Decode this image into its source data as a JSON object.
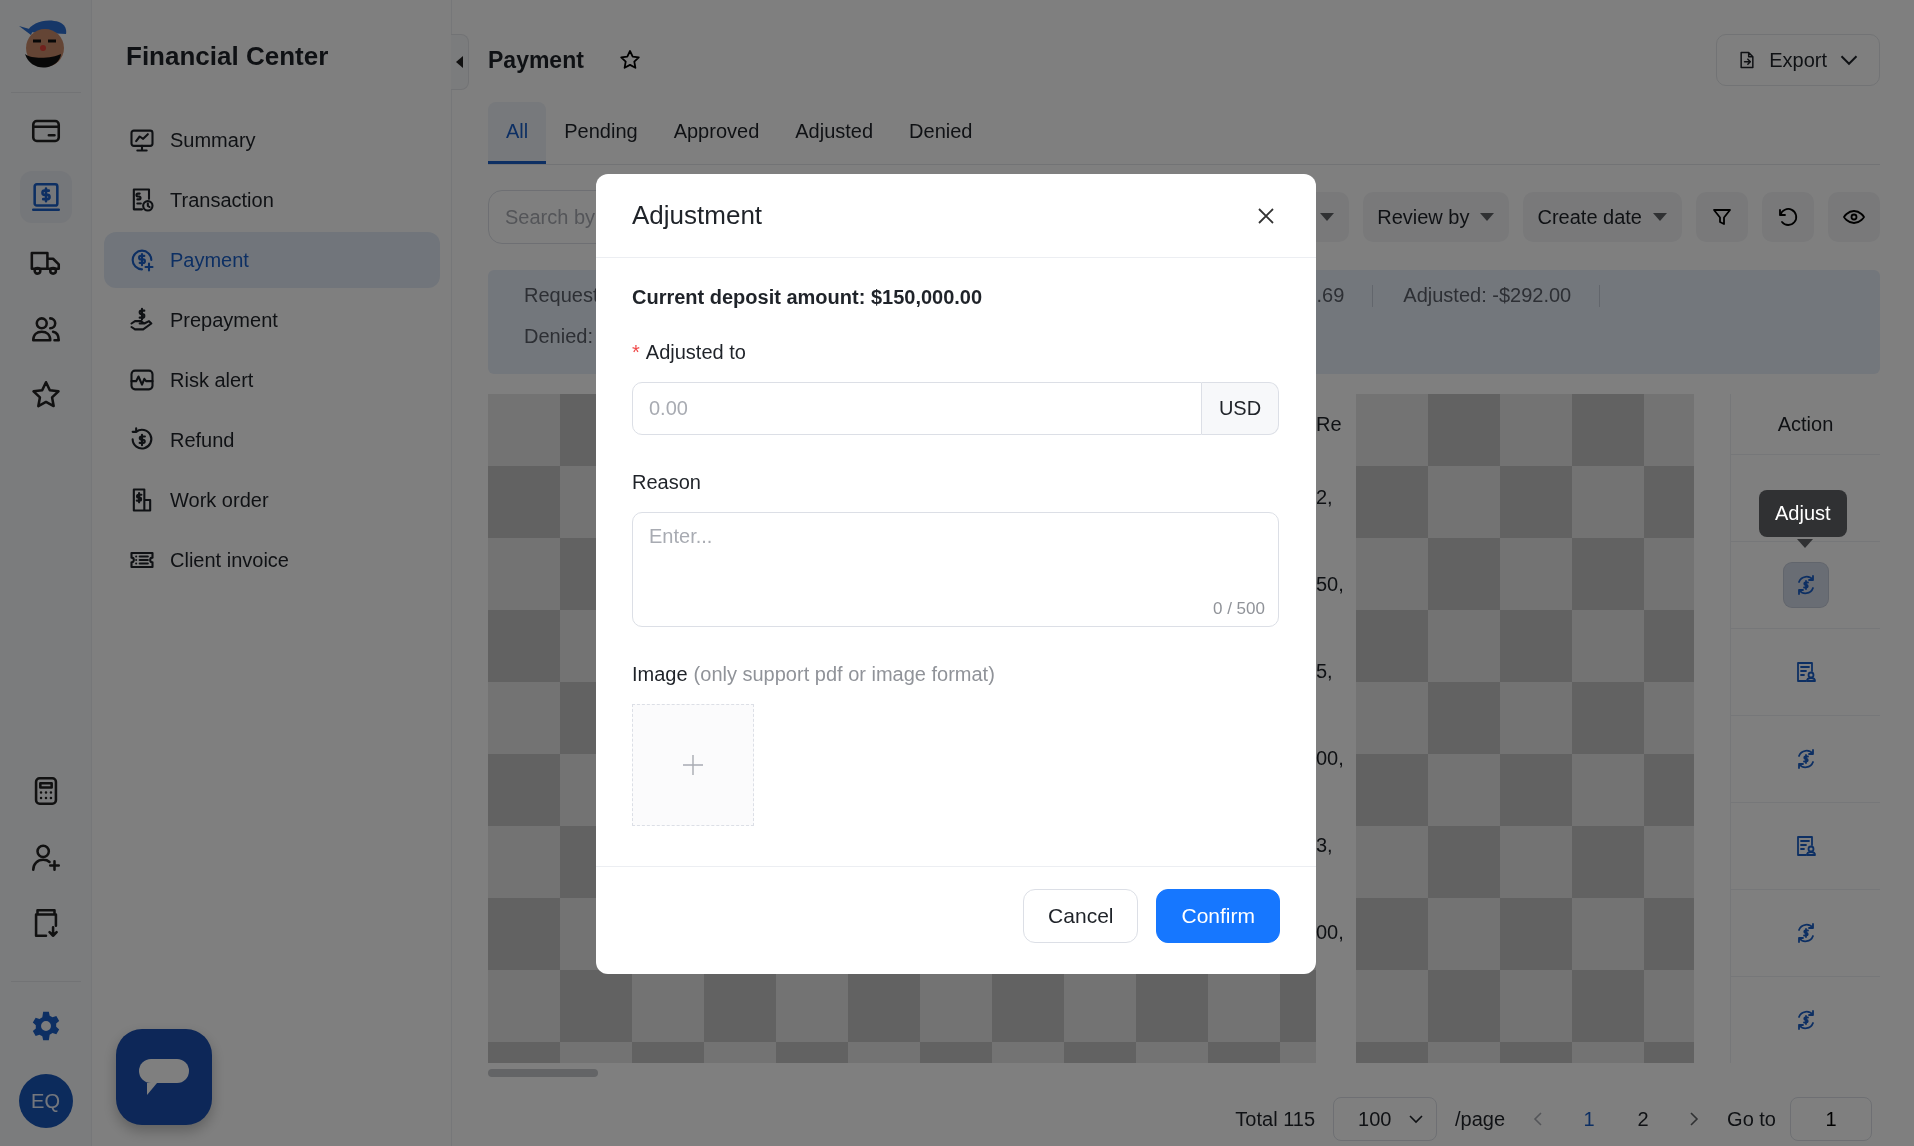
{
  "rail": {
    "items": [
      {
        "kind": "card",
        "selected": false
      },
      {
        "kind": "dollar",
        "selected": true
      },
      {
        "kind": "truck",
        "selected": false
      },
      {
        "kind": "users",
        "selected": false
      },
      {
        "kind": "star",
        "selected": false
      }
    ],
    "lower_items": [
      {
        "kind": "calculator",
        "selected": false
      },
      {
        "kind": "adduser",
        "selected": false
      },
      {
        "kind": "download",
        "selected": false
      }
    ],
    "avatar": "EQ"
  },
  "sidebar": {
    "title": "Financial Center",
    "items": [
      {
        "label": "Summary",
        "selected": false
      },
      {
        "label": "Transaction",
        "selected": false
      },
      {
        "label": "Payment",
        "selected": true
      },
      {
        "label": "Prepayment",
        "selected": false
      },
      {
        "label": "Risk alert",
        "selected": false
      },
      {
        "label": "Refund",
        "selected": false
      },
      {
        "label": "Work order",
        "selected": false
      },
      {
        "label": "Client invoice",
        "selected": false
      }
    ]
  },
  "page": {
    "title": "Payment",
    "favorite": false,
    "export": "Export"
  },
  "tabs": [
    {
      "label": "All",
      "selected": true
    },
    {
      "label": "Pending",
      "selected": false
    },
    {
      "label": "Approved",
      "selected": false
    },
    {
      "label": "Adjusted",
      "selected": false
    },
    {
      "label": "Denied",
      "selected": false
    }
  ],
  "toolbar": {
    "search": {
      "placeholder": "Search by"
    },
    "filters": [
      {
        "kind": "dropdown"
      },
      {
        "kind": "dropdown",
        "label": "Review by"
      },
      {
        "kind": "dropdown",
        "label": "Create date"
      }
    ],
    "tools": [
      {
        "kind": "filter"
      },
      {
        "kind": "refresh"
      },
      {
        "kind": "eye"
      }
    ]
  },
  "summary": {
    "rows": [
      [
        "Request",
        ".69",
        "Adjusted: -$292.00"
      ],
      [
        "Denied:"
      ]
    ]
  },
  "table": {
    "columns": [
      {
        "label": "Re"
      },
      {
        "label": "Action"
      }
    ],
    "rows": [
      {
        "column_2": "2,"
      },
      {
        "column_2": "50,",
        "kind": "adjust",
        "hovered": true,
        "tooltip": "Adjust"
      },
      {
        "column_2": "5,",
        "kind": "review",
        "hovered": false
      },
      {
        "column_2": "00,",
        "kind": "adjust",
        "hovered": false
      },
      {
        "column_2": "3,",
        "kind": "review",
        "hovered": false
      },
      {
        "column_2": "00,",
        "kind": "adjust",
        "hovered": false
      },
      {
        "kind": "adjust",
        "hovered": false
      }
    ]
  },
  "pagination": {
    "total": "Total 115",
    "page_size": "100",
    "per_page": "/page",
    "pages": [
      {
        "label": "1",
        "selected": true
      },
      {
        "label": "2",
        "selected": false
      }
    ],
    "goto_label": "Go to",
    "goto_value": "1"
  },
  "modal": {
    "title": "Adjustment",
    "deposit": "Current deposit amount: $150,000.00",
    "amount": {
      "required_mark": "*",
      "label": "Adjusted to",
      "placeholder": "0.00",
      "unit": "USD"
    },
    "reason": {
      "label": "Reason",
      "placeholder": "Enter...",
      "counter": "0 / 500"
    },
    "image": {
      "label": "Image",
      "hint": "(only support pdf or image format)"
    },
    "buttons": [
      {
        "kind": "secondary",
        "label": "Cancel"
      },
      {
        "kind": "primary",
        "label": "Confirm"
      }
    ]
  }
}
